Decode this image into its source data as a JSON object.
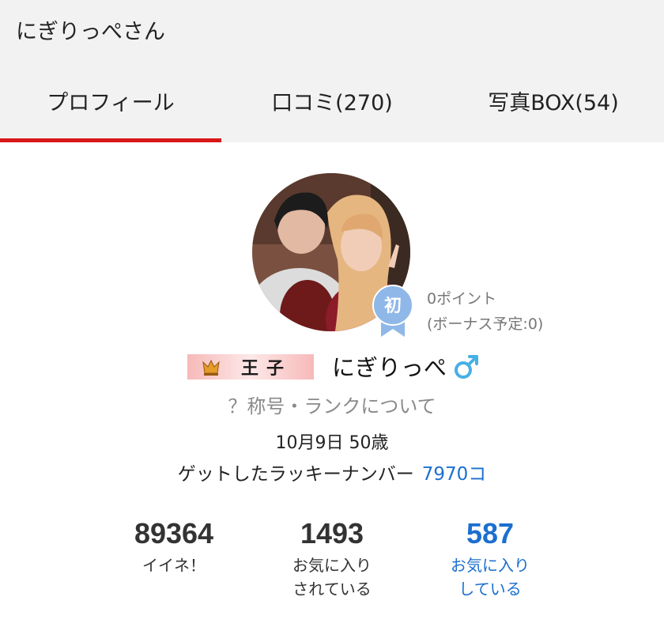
{
  "page": {
    "title": "にぎりっぺさん"
  },
  "tabs": [
    {
      "label": "プロフィール",
      "active": true
    },
    {
      "label": "口コミ(270)"
    },
    {
      "label": "写真BOX(54)"
    }
  ],
  "profile": {
    "badge_char": "初",
    "points_line1": "0ポイント",
    "points_line2": "(ボーナス予定:0)",
    "rank_title": "王子",
    "name": "にぎりっぺ",
    "gender_symbol": "♂",
    "rank_link": "？称号・ランクについて",
    "birthday_age": "10月9日 50歳",
    "lucky_label": "ゲットしたラッキーナンバー",
    "lucky_value": "7970コ"
  },
  "stats": [
    {
      "value": "89364",
      "label_line1": "イイネ！",
      "label_line2": ""
    },
    {
      "value": "1493",
      "label_line1": "お気に入り",
      "label_line2": "されている"
    },
    {
      "value": "587",
      "label_line1": "お気に入り",
      "label_line2": "している"
    }
  ],
  "colors": {
    "accent_red": "#d81818",
    "link_blue": "#1b6fcf",
    "badge_blue": "#8fb8e8",
    "male_blue": "#45b0e5",
    "header_bg": "#f2f2f2"
  },
  "icons": {
    "rank_crown": "crown-icon",
    "gender": "male-icon",
    "badge": "ribbon-badge-icon"
  }
}
